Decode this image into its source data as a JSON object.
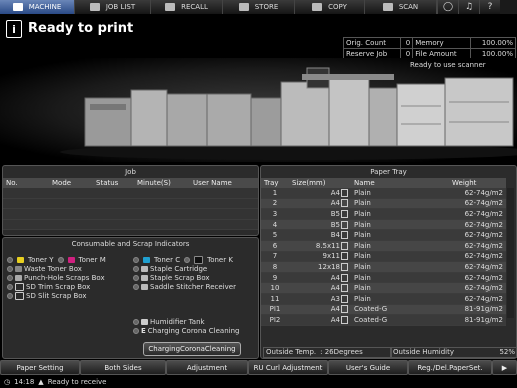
{
  "tabs": [
    {
      "label": "MACHINE",
      "icon": "machine-icon"
    },
    {
      "label": "JOB LIST",
      "icon": "joblist-icon"
    },
    {
      "label": "RECALL",
      "icon": "recall-icon"
    },
    {
      "label": "STORE",
      "icon": "store-icon"
    },
    {
      "label": "COPY",
      "icon": "copy-icon"
    },
    {
      "label": "SCAN",
      "icon": "scan-icon"
    }
  ],
  "message": {
    "text": "Ready to print"
  },
  "counters": {
    "orig_count_label": "Orig. Count",
    "orig_count_value": "0",
    "memory_label": "Memory",
    "memory_value": "100.00%",
    "reserve_job_label": "Reserve Job",
    "reserve_job_value": "0",
    "file_amount_label": "File Amount",
    "file_amount_value": "100.00%",
    "scanner_status": "Ready to use scanner"
  },
  "job": {
    "title": "Job",
    "headers": [
      "No.",
      "Mode",
      "Status",
      "Minute(S)",
      "User Name"
    ]
  },
  "consumables": {
    "title": "Consumable and Scrap Indicators",
    "toner_y": "Toner Y",
    "toner_m": "Toner M",
    "toner_c": "Toner C",
    "toner_k": "Toner K",
    "waste_toner": "Waste Toner Box",
    "punch_hole": "Punch-Hole Scraps Box",
    "sd_trim": "SD Trim Scrap Box",
    "sd_slit": "SD Slit Scrap Box",
    "staple_cartridge": "Staple Cartridge",
    "staple_scrap": "Staple Scrap Box",
    "saddle_stitcher": "Saddle Stitcher Receiver",
    "humidifier": "Humidifier Tank",
    "charging_corona": "Charging Corona Cleaning",
    "charging_button": "ChargingCoronaCleaning",
    "colors": {
      "yellow": "#e8d020",
      "magenta": "#d02080",
      "cyan": "#20a0d0",
      "black": "#111111"
    }
  },
  "paper_tray": {
    "title": "Paper Tray",
    "headers": [
      "Tray",
      "Size(mm)",
      "Name",
      "Weight"
    ],
    "rows": [
      {
        "tray": "1",
        "size": "A4",
        "name": "Plain",
        "weight": "62-74g/m2"
      },
      {
        "tray": "2",
        "size": "A4",
        "name": "Plain",
        "weight": "62-74g/m2"
      },
      {
        "tray": "3",
        "size": "B5",
        "name": "Plain",
        "weight": "62-74g/m2"
      },
      {
        "tray": "4",
        "size": "B5",
        "name": "Plain",
        "weight": "62-74g/m2"
      },
      {
        "tray": "5",
        "size": "B4",
        "name": "Plain",
        "weight": "62-74g/m2"
      },
      {
        "tray": "6",
        "size": "8.5x11",
        "name": "Plain",
        "weight": "62-74g/m2"
      },
      {
        "tray": "7",
        "size": "9x11",
        "name": "Plain",
        "weight": "62-74g/m2"
      },
      {
        "tray": "8",
        "size": "12x18",
        "name": "Plain",
        "weight": "62-74g/m2"
      },
      {
        "tray": "9",
        "size": "A4",
        "name": "Plain",
        "weight": "62-74g/m2"
      },
      {
        "tray": "10",
        "size": "A4",
        "name": "Plain",
        "weight": "62-74g/m2"
      },
      {
        "tray": "11",
        "size": "A3",
        "name": "Plain",
        "weight": "62-74g/m2"
      },
      {
        "tray": "PI1",
        "size": "A4",
        "name": "Coated-G",
        "weight": "81-91g/m2"
      },
      {
        "tray": "PI2",
        "size": "A4",
        "name": "Coated-G",
        "weight": "81-91g/m2"
      }
    ],
    "outside_temp_label": "Outside Temp.",
    "outside_temp_value": ": 26Degrees",
    "outside_humidity_label": "Outside Humidity",
    "outside_humidity_value": "52%"
  },
  "bottom_buttons": [
    "Paper Setting",
    "Both Sides",
    "Adjustment",
    "RU Curl Adjustment",
    "User's Guide",
    "Reg./Del.PaperSet."
  ],
  "status_bar": {
    "time": "14:18",
    "text": "Ready to receive"
  }
}
